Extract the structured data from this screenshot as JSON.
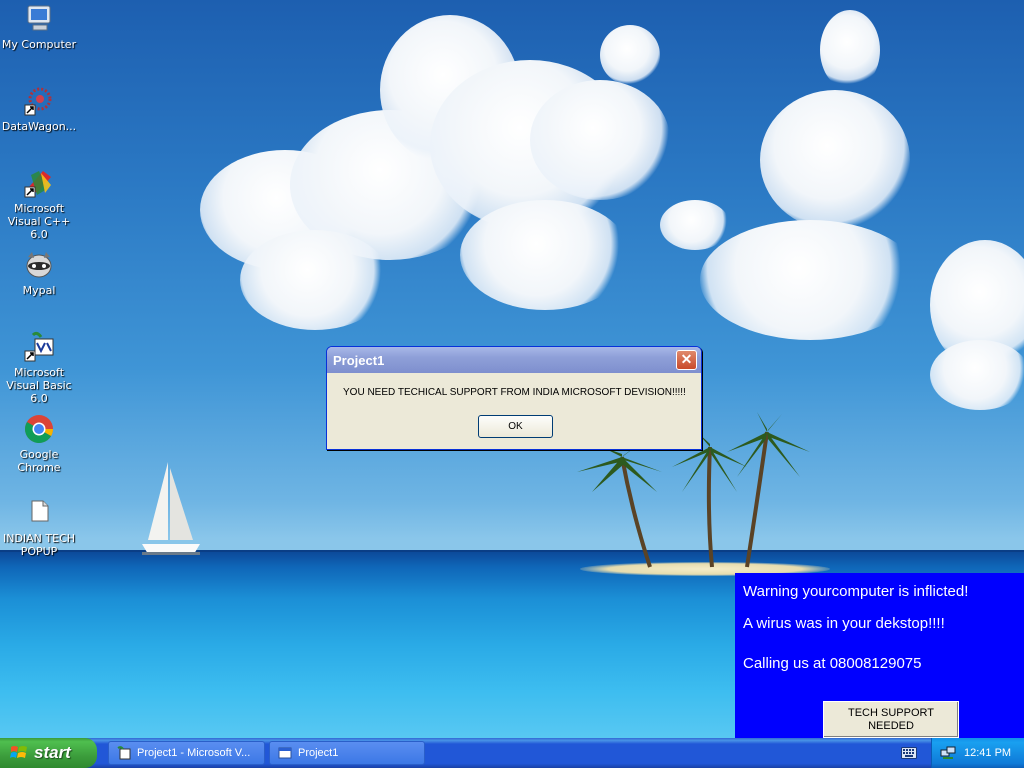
{
  "desktop": {
    "icons": [
      {
        "label": "My Computer",
        "icon": "my-computer-icon"
      },
      {
        "label": "DataWagon...",
        "icon": "datawagon-icon"
      },
      {
        "label": "Microsoft Visual C++ 6.0",
        "icon": "visual-cpp-icon"
      },
      {
        "label": "Mypal",
        "icon": "mypal-browser-icon"
      },
      {
        "label": "Microsoft Visual Basic 6.0",
        "icon": "visual-basic-icon"
      },
      {
        "label": "Google Chrome",
        "icon": "chrome-icon"
      },
      {
        "label": "INDIAN TECH POPUP",
        "icon": "document-icon"
      }
    ]
  },
  "dialog": {
    "title": "Project1",
    "message": "YOU NEED TECHICAL SUPPORT FROM INDIA MICROSOFT DEVISION!!!!!",
    "ok_label": "OK",
    "close_glyph": "✕"
  },
  "popup": {
    "line1": "Warning yourcomputer is inflicted!",
    "line2": "A wirus was in your dekstop!!!!",
    "line3": "Calling us at 08008129075",
    "button_label": "TECH SUPPORT NEEDED",
    "background": "#0000ff"
  },
  "taskbar": {
    "start_label": "start",
    "tasks": [
      {
        "label": "Project1 - Microsoft V...",
        "icon": "vb-project-icon"
      },
      {
        "label": "Project1",
        "icon": "window-icon"
      }
    ],
    "clock": "12:41 PM"
  },
  "colors": {
    "taskbar_blue": "#2157d7",
    "start_green": "#3c9d3c",
    "dialog_face": "#ece9d8"
  }
}
